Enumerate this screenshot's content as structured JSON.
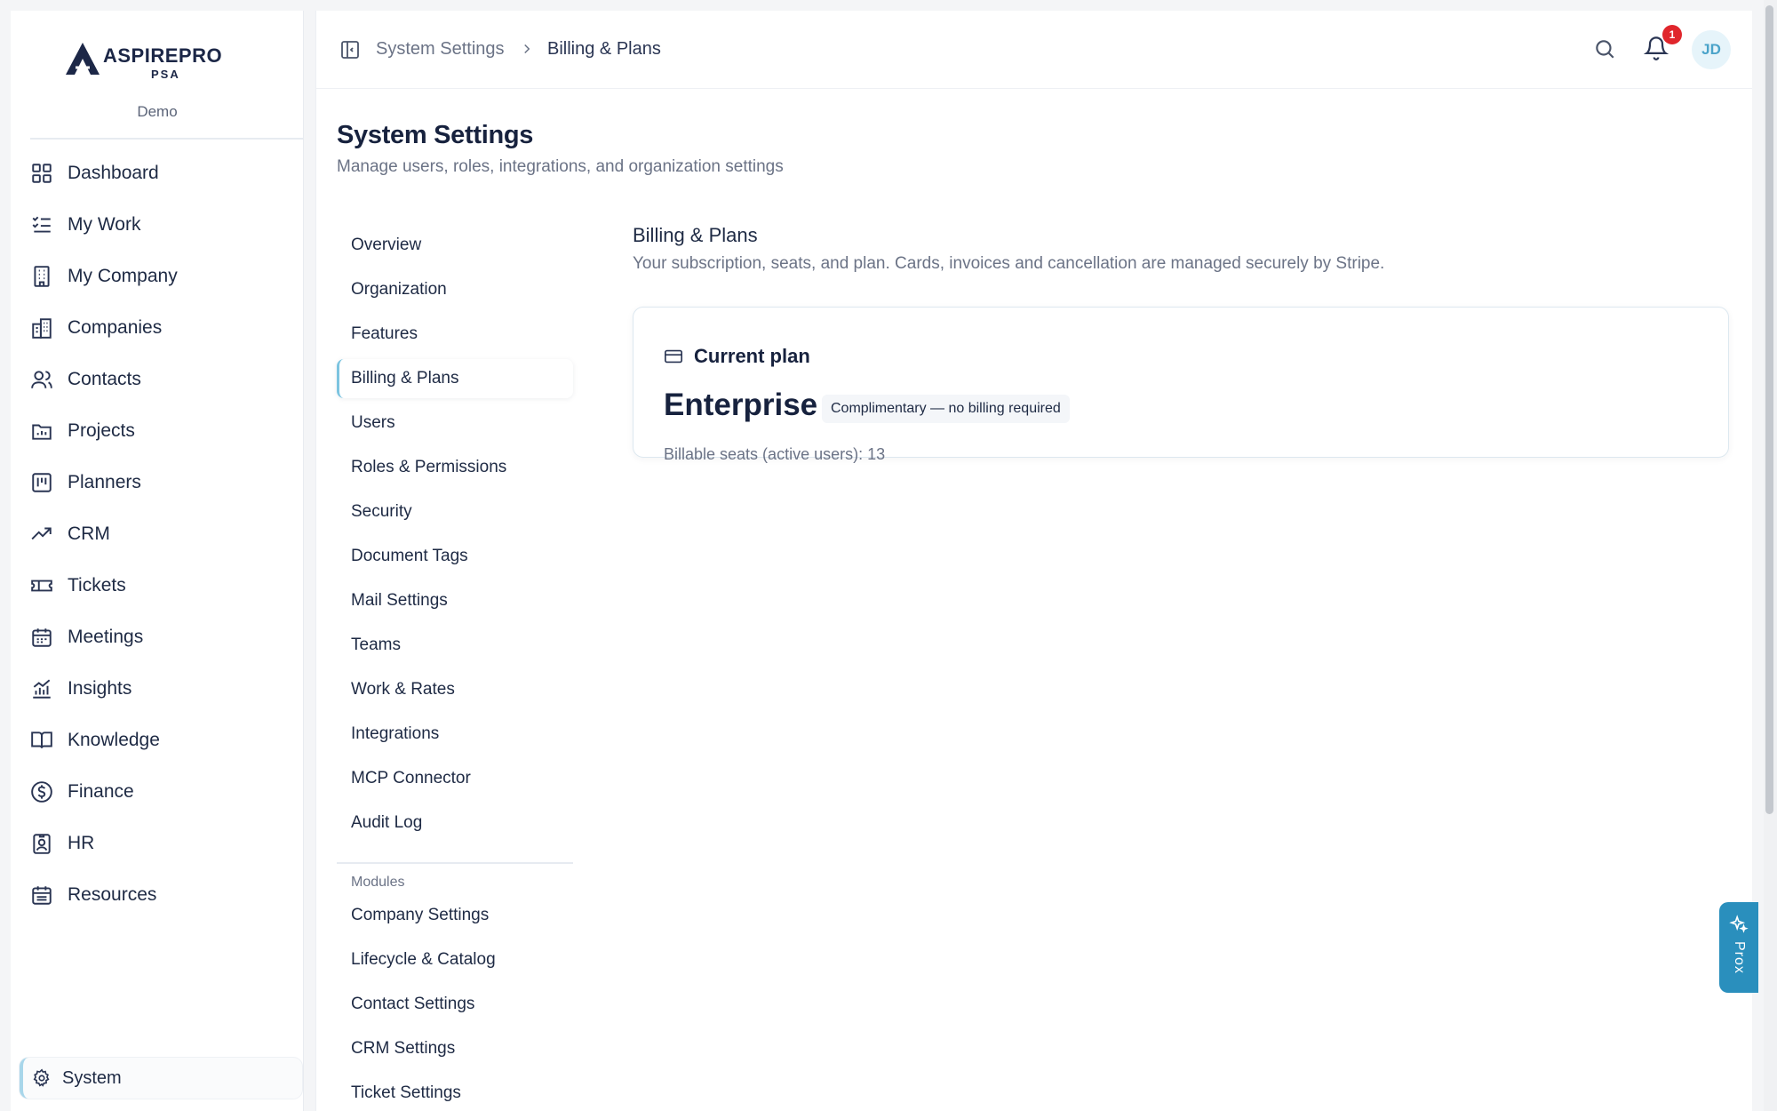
{
  "app": {
    "logo_text": "ASPIREPRO",
    "logo_sub": "PSA",
    "workspace": "Demo"
  },
  "sidebar": {
    "items": [
      {
        "label": "Dashboard",
        "icon": "grid-icon"
      },
      {
        "label": "My Work",
        "icon": "list-checks-icon"
      },
      {
        "label": "My Company",
        "icon": "building-icon"
      },
      {
        "label": "Companies",
        "icon": "buildings-icon"
      },
      {
        "label": "Contacts",
        "icon": "users-icon"
      },
      {
        "label": "Projects",
        "icon": "folder-chart-icon"
      },
      {
        "label": "Planners",
        "icon": "kanban-icon"
      },
      {
        "label": "CRM",
        "icon": "trending-up-icon"
      },
      {
        "label": "Tickets",
        "icon": "ticket-icon"
      },
      {
        "label": "Meetings",
        "icon": "calendar-icon"
      },
      {
        "label": "Insights",
        "icon": "bar-chart-icon"
      },
      {
        "label": "Knowledge",
        "icon": "book-open-icon"
      },
      {
        "label": "Finance",
        "icon": "dollar-circle-icon"
      },
      {
        "label": "HR",
        "icon": "id-badge-icon"
      },
      {
        "label": "Resources",
        "icon": "calendar-list-icon"
      }
    ],
    "system_label": "System"
  },
  "topbar": {
    "breadcrumb_parent": "System Settings",
    "breadcrumb_current": "Billing & Plans",
    "notification_count": "1",
    "avatar_initials": "JD"
  },
  "page": {
    "title": "System Settings",
    "subtitle": "Manage users, roles, integrations, and organization settings"
  },
  "settings_nav": {
    "items": [
      "Overview",
      "Organization",
      "Features",
      "Billing & Plans",
      "Users",
      "Roles & Permissions",
      "Security",
      "Document Tags",
      "Mail Settings",
      "Teams",
      "Work & Rates",
      "Integrations",
      "MCP Connector",
      "Audit Log"
    ],
    "active_index": 3,
    "modules_heading": "Modules",
    "module_items": [
      "Company Settings",
      "Lifecycle & Catalog",
      "Contact Settings",
      "CRM Settings",
      "Ticket Settings"
    ]
  },
  "content": {
    "title": "Billing & Plans",
    "subtitle": "Your subscription, seats, and plan. Cards, invoices and cancellation are managed securely by Stripe.",
    "card": {
      "title": "Current plan",
      "plan_name": "Enterprise",
      "badge": "Complimentary — no billing required",
      "seats": "Billable seats (active users): 13"
    }
  },
  "assistant_tab": {
    "label": "Prox"
  },
  "colors": {
    "accent": "#2a8fbd",
    "active_indicator": "#7cc4e0",
    "badge_red": "#e0262c",
    "text_primary": "#1e2a44",
    "text_muted": "#6b7386"
  }
}
